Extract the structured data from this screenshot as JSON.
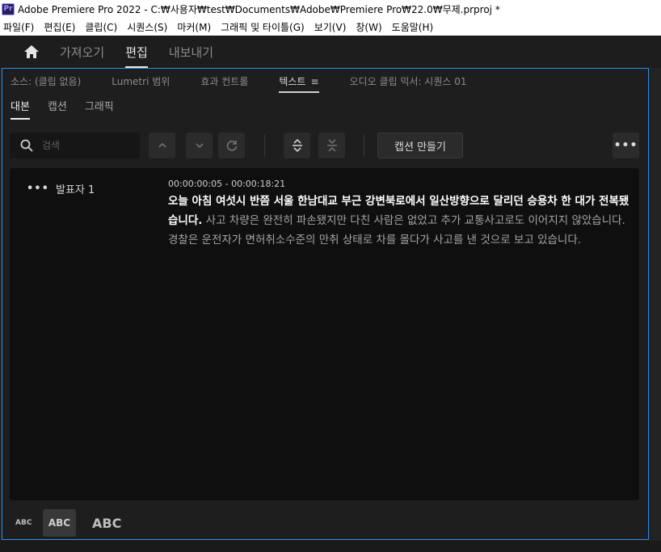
{
  "window": {
    "icon": "Pr",
    "title": "Adobe Premiere Pro 2022 - C:₩사용자₩test₩Documents₩Adobe₩Premiere Pro₩22.0₩무제.prproj *"
  },
  "menu": [
    "파일(F)",
    "편집(E)",
    "클립(C)",
    "시퀀스(S)",
    "마커(M)",
    "그래픽 및 타이틀(G)",
    "보기(V)",
    "창(W)",
    "도움말(H)"
  ],
  "workspace": {
    "home_icon": "home-icon",
    "tabs": [
      "가져오기",
      "편집",
      "내보내기"
    ],
    "active": "편집"
  },
  "panel_tabs": {
    "items": [
      "소스: (클립 없음)",
      "Lumetri 범위",
      "효과 컨트롤",
      "텍스트",
      "오디오 클립 믹서: 시퀀스 01"
    ],
    "active": "텍스트",
    "menu_glyph": "≡"
  },
  "sub_tabs": {
    "items": [
      "대본",
      "캡션",
      "그래픽"
    ],
    "active": "대본"
  },
  "toolbar": {
    "search_placeholder": "검색",
    "icons": [
      "search-icon",
      "chevron-up-icon",
      "chevron-down-icon",
      "refresh-icon",
      "expand-icon",
      "collapse-icon",
      "more-icon"
    ],
    "caption_button": "캡션 만들기",
    "more_label": "•••"
  },
  "transcript": {
    "speaker_dots": "•••",
    "speaker": "발표자 1",
    "timecode": "00:00:00:05 - 00:00:18:21",
    "highlight": "오늘 아침 여섯시 반쯤 서울 한남대교 부근 강변북로에서 일산방향으로 달리던 승용차 한 대가 전복됐습니다.",
    "rest": " 사고 차량은 완전히 파손됐지만 다친 사람은 없었고 추가 교통사고로도 이어지지 않았습니다. 경찰은 운전자가 면허취소수준의 만취 상태로 차를 몰다가 사고를 낸 것으로 보고 있습니다."
  },
  "footer": {
    "abc_small": "ABC",
    "abc_medium": "ABC",
    "abc_large": "ABC"
  },
  "colors": {
    "panel_border": "#2d8ceb",
    "background": "#1e1e1e",
    "transcript_bg": "#0f0f0f"
  }
}
